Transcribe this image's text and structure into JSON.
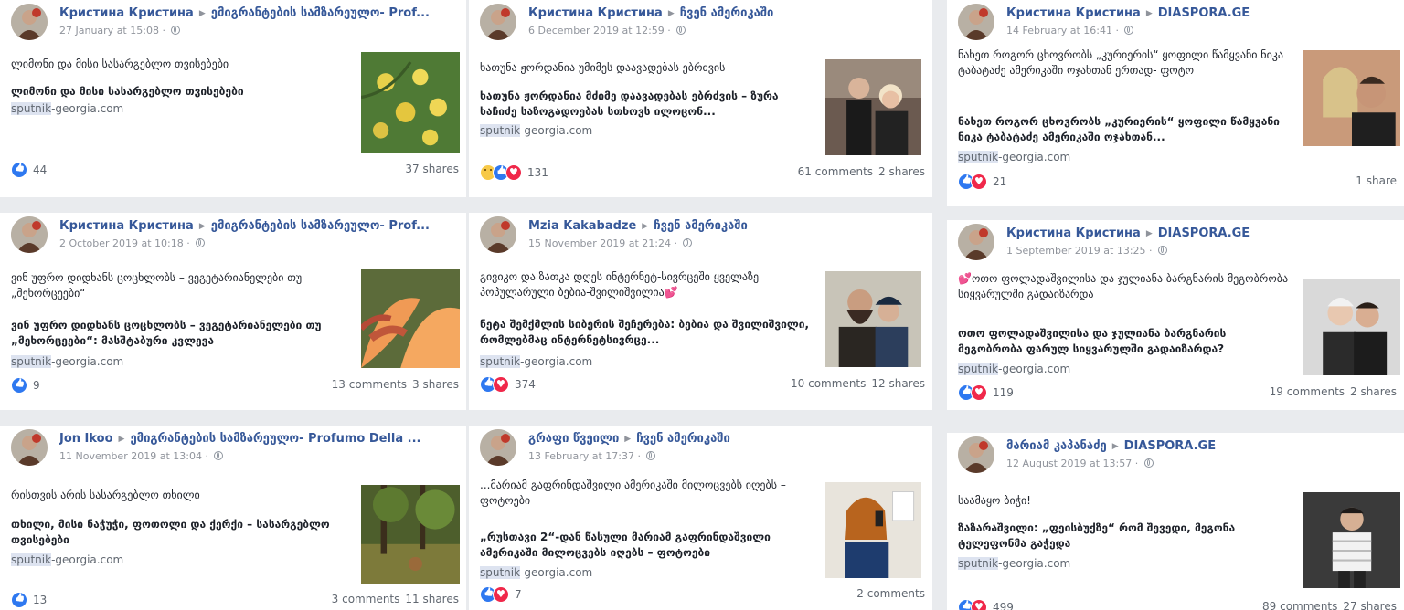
{
  "posts": [
    {
      "author": "Кристина Кристина",
      "group": "ემიგრანტების სამზარეულო- Prof...",
      "time": "27 January at 15:08 ·",
      "message": "ლიმონი და მისი სასარგებლო თვისებები",
      "link_title": "ლიმონი და მისი სასარგებლო თვისებები",
      "domain_hl": "sputnik",
      "domain_rest": "-georgia.com",
      "reactions": [
        "like"
      ],
      "reaction_count": "44",
      "comments": "",
      "shares": "37 shares",
      "thumb": "lemons"
    },
    {
      "author": "Кристина Кристина",
      "group": "ჩვენ ამერიკაში",
      "time": "6 December 2019 at 12:59 ·",
      "message": "ხათუნა ჟორდანია უმიმეს დაავადებას ებრძვის",
      "link_title": "ხათუნა ჟორდანია მძიმე დაავადებას ებრძვის – ზურა ხაჩიძე საზოგადოებას სთხოვს ილოცონ...",
      "domain_hl": "sputnik",
      "domain_rest": "-georgia.com",
      "reactions": [
        "sad",
        "like",
        "love"
      ],
      "reaction_count": "131",
      "comments": "61 comments",
      "shares": "2 shares",
      "thumb": "couple"
    },
    {
      "author": "Кристина Кристина",
      "group": "DIASPORA.GE",
      "time": "14 February at 16:41 ·",
      "message": "ნახეთ როგორ ცხოვრობს „კურიერის“ ყოფილი წამყვანი ნიკა ტაბატაძე ამერიკაში ოჯახთან ერთად- ფოტო",
      "link_title": "ნახეთ როგორ ცხოვრობს „კურიერის“ ყოფილი წამყვანი ნიკა ტაბატაძე ამერიკაში ოჯახთან...",
      "domain_hl": "sputnik",
      "domain_rest": "-georgia.com",
      "reactions": [
        "like",
        "love"
      ],
      "reaction_count": "21",
      "comments": "",
      "shares": "1 share",
      "thumb": "selfie"
    },
    {
      "author": "Кристина Кристина",
      "group": "ემიგრანტების სამზარეულო- Prof...",
      "time": "2 October 2019 at 10:18 ·",
      "message": "ვინ უფრო დიდხანს ცოცხლობს – ვეგეტარიანელები თუ „მეხორცეები“",
      "link_title": "ვინ უფრო დიდხანს ცოცხლობს – ვეგეტარიანელები თუ „მეხორცეები“: მასშტაბური კვლევა",
      "domain_hl": "sputnik",
      "domain_rest": "-georgia.com",
      "reactions": [
        "like"
      ],
      "reaction_count": "9",
      "comments": "13 comments",
      "shares": "3 shares",
      "thumb": "melon"
    },
    {
      "author": "Mzia Kakabadze",
      "group": "ჩვენ ამერიკაში",
      "time": "15 November 2019 at 21:24 ·",
      "message": "გივიკო და ზათკა დღეს ინტერნეტ-სივრცეში ყველაზე პოპულარული ბებია-შვილიშვილია💕",
      "link_title": "ნეტა შემქმლის სიბერის შეჩერება: ბებია და შვილიშვილი, რომლებმაც ინტერნეტსივრცე...",
      "domain_hl": "sputnik",
      "domain_rest": "-georgia.com",
      "reactions": [
        "like",
        "love"
      ],
      "reaction_count": "374",
      "comments": "10 comments",
      "shares": "12 shares",
      "thumb": "grandma"
    },
    {
      "author": "Кристина Кристина",
      "group": "DIASPORA.GE",
      "time": "1 September 2019 at 13:25 ·",
      "message": "💕ოთო ფოლადაშვილისა და ჯულიანა ბარგნარის მეგობრობა სიყვარულში გადაიზარდა",
      "link_title": "ოთო ფოლადაშვილისა და ჯულიანა ბარგნარის მეგობრობა ფარულ სიყვარულში გადაიზარდა?",
      "domain_hl": "sputnik",
      "domain_rest": "-georgia.com",
      "reactions": [
        "like",
        "love"
      ],
      "reaction_count": "119",
      "comments": "19 comments",
      "shares": "2 shares",
      "thumb": "pair"
    },
    {
      "author": "Jon Ikoo",
      "group": "ემიგრანტების სამზარეულო- Profumo Della ...",
      "time": "11 November 2019 at 13:04 ·",
      "message": "რისთვის არის სასარგებლო თხილი",
      "link_title": "თხილი, მისი ნაჭუჭი, ფოთოლი და ქერქი – სასარგებლო თვისებები",
      "domain_hl": "sputnik",
      "domain_rest": "-georgia.com",
      "reactions": [
        "like"
      ],
      "reaction_count": "13",
      "comments": "3 comments",
      "shares": "11 shares",
      "thumb": "forest"
    },
    {
      "author": "გრაფი წვეილი",
      "group": "ჩვენ ამერიკაში",
      "time": "13 February at 17:37 ·",
      "message": "...მარიამ გაფრინდაშვილი ამერიკაში მილოცვებს იღებს – ფოტოები",
      "link_title": "„რუსთავი 2“-დან წასული მარიამ გაფრინდაშვილი ამერიკაში მილოცვებს იღებს – ფოტოები",
      "domain_hl": "sputnik",
      "domain_rest": "-georgia.com",
      "reactions": [
        "like",
        "love"
      ],
      "reaction_count": "7",
      "comments": "2 comments",
      "shares": "",
      "thumb": "phone"
    },
    {
      "author": "მარიამ კაპანაძე",
      "group": "DIASPORA.GE",
      "time": "12 August 2019 at 13:57 ·",
      "message": "საამაყო ბიჭი!",
      "link_title": "ზაზარაშვილი: „ფეისბუქზე“ რომ შევედი, მეგონა ტელეფონმა გაჭედა",
      "domain_hl": "sputnik",
      "domain_rest": "-georgia.com",
      "reactions": [
        "like",
        "love"
      ],
      "reaction_count": "499",
      "comments": "89 comments",
      "shares": "27 shares",
      "thumb": "boy"
    }
  ],
  "colors": {
    "link": "#365899",
    "muted": "#90949c",
    "like": "#2e78f0",
    "love": "#f0284a",
    "background": "#e9ebee"
  }
}
